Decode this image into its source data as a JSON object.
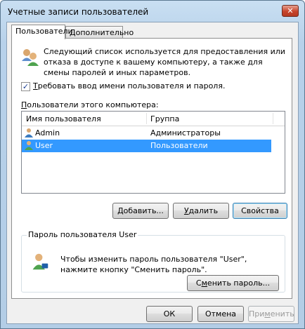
{
  "window": {
    "title": "Учетные записи пользователей",
    "close_glyph": "✕"
  },
  "tabs": [
    {
      "label": "Пользователи"
    },
    {
      "label": "Дополнительно"
    }
  ],
  "intro": {
    "text": "Следующий список используется для предоставления или отказа в доступе к вашему компьютеру, а также для смены паролей и иных параметров.",
    "icon": "users-icon"
  },
  "require_password": {
    "checked": true,
    "check_glyph": "✓",
    "label_prefix": "",
    "label_accel": "Т",
    "label_rest": "ребовать ввод имени пользователя и пароля."
  },
  "users_list": {
    "label_accel": "П",
    "label_rest": "ользователи этого компьютера:",
    "columns": [
      "Имя пользователя",
      "Группа"
    ],
    "rows": [
      {
        "name": "Admin",
        "group": "Администраторы",
        "selected": false
      },
      {
        "name": "User",
        "group": "Пользователи",
        "selected": true
      }
    ]
  },
  "list_buttons": {
    "add": {
      "accel": "Д",
      "rest": "обавить..."
    },
    "remove": {
      "accel": "У",
      "rest": "далить"
    },
    "properties": "Свойства"
  },
  "password_group": {
    "legend": "Пароль пользователя User",
    "text": "Чтобы изменить пароль пользователя \"User\", нажмите кнопку \"Сменить пароль\".",
    "button_prefix": "С",
    "button_accel": "м",
    "button_rest": "енить пароль..."
  },
  "dialog_buttons": {
    "ok": "ОК",
    "cancel": "Отмена",
    "apply_prefix": "При",
    "apply_accel": "м",
    "apply_rest": "енить"
  },
  "colors": {
    "selection": "#3399ff",
    "title_bar": "#c9dff2",
    "close_button": "#c7442c"
  }
}
